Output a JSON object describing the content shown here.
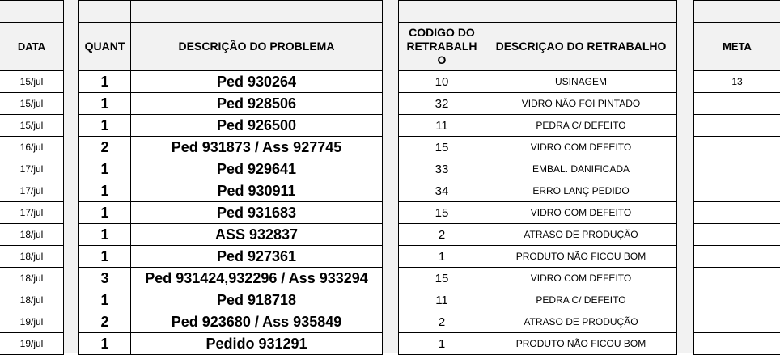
{
  "headers": {
    "data": "DATA",
    "quant": "QUANT",
    "descricao_problema": "DESCRIÇÃO DO PROBLEMA",
    "codigo_retrabalho": "CODIGO DO RETRABALH O",
    "descricao_retrabalho": "DESCRIÇAO DO RETRABALHO",
    "meta": "META"
  },
  "rows": [
    {
      "data": "15/jul",
      "quant": "1",
      "problema": "Ped 930264",
      "codigo": "10",
      "retrabalho": "USINAGEM",
      "meta": "13"
    },
    {
      "data": "15/jul",
      "quant": "1",
      "problema": "Ped 928506",
      "codigo": "32",
      "retrabalho": "VIDRO NÃO FOI PINTADO",
      "meta": ""
    },
    {
      "data": "15/jul",
      "quant": "1",
      "problema": "Ped 926500",
      "codigo": "11",
      "retrabalho": "PEDRA C/ DEFEITO",
      "meta": ""
    },
    {
      "data": "16/jul",
      "quant": "2",
      "problema": "Ped 931873 / Ass 927745",
      "codigo": "15",
      "retrabalho": "VIDRO COM DEFEITO",
      "meta": ""
    },
    {
      "data": "17/jul",
      "quant": "1",
      "problema": "Ped 929641",
      "codigo": "33",
      "retrabalho": "EMBAL. DANIFICADA",
      "meta": ""
    },
    {
      "data": "17/jul",
      "quant": "1",
      "problema": "Ped 930911",
      "codigo": "34",
      "retrabalho": "ERRO LANÇ PEDIDO",
      "meta": ""
    },
    {
      "data": "17/jul",
      "quant": "1",
      "problema": "Ped 931683",
      "codigo": "15",
      "retrabalho": "VIDRO COM DEFEITO",
      "meta": ""
    },
    {
      "data": "18/jul",
      "quant": "1",
      "problema": "ASS 932837",
      "codigo": "2",
      "retrabalho": "ATRASO DE PRODUÇÃO",
      "meta": ""
    },
    {
      "data": "18/jul",
      "quant": "1",
      "problema": "Ped 927361",
      "codigo": "1",
      "retrabalho": "PRODUTO NÃO FICOU BOM",
      "meta": ""
    },
    {
      "data": "18/jul",
      "quant": "3",
      "problema": "Ped 931424,932296 / Ass 933294",
      "codigo": "15",
      "retrabalho": "VIDRO COM DEFEITO",
      "meta": ""
    },
    {
      "data": "18/jul",
      "quant": "1",
      "problema": "Ped 918718",
      "codigo": "11",
      "retrabalho": "PEDRA C/ DEFEITO",
      "meta": ""
    },
    {
      "data": "19/jul",
      "quant": "2",
      "problema": "Ped 923680 / Ass 935849",
      "codigo": "2",
      "retrabalho": "ATRASO DE PRODUÇÃO",
      "meta": ""
    },
    {
      "data": "19/jul",
      "quant": "1",
      "problema": "Pedido 931291",
      "codigo": "1",
      "retrabalho": "PRODUTO NÃO FICOU BOM",
      "meta": ""
    }
  ]
}
